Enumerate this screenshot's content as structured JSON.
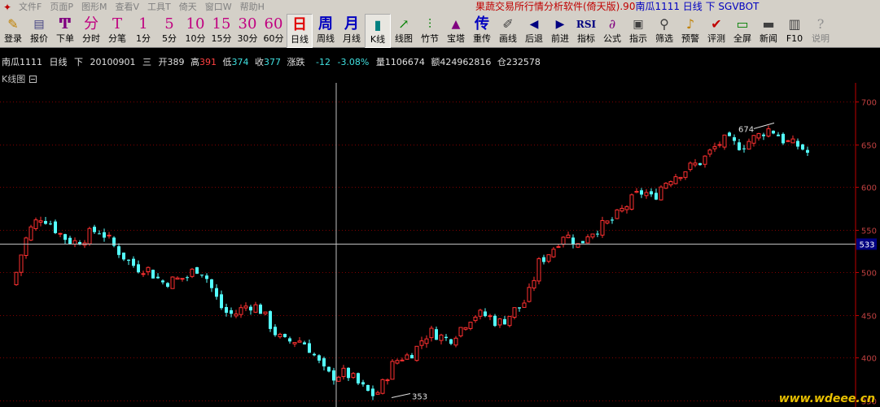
{
  "menu": {
    "items": [
      "文件F",
      "页面P",
      "图形M",
      "查看V",
      "工具T",
      "倚天",
      "窗口W",
      "帮助H"
    ],
    "title": "果蔬交易所行情分析软件(倚天版).90",
    "title_tail": "南瓜1111 日线 下 SGVBOT"
  },
  "toolbar": {
    "buttons": [
      {
        "id": "login",
        "glyph": "✎",
        "label": "登录"
      },
      {
        "id": "quote",
        "glyph": "▤",
        "label": "报价"
      },
      {
        "id": "order",
        "glyph": "Ͳ",
        "label": "下单"
      },
      {
        "id": "timeshare",
        "glyph": "分",
        "label": "分时"
      },
      {
        "id": "tick",
        "glyph": "T",
        "label": "分笔"
      },
      {
        "id": "m1",
        "glyph": "1",
        "label": "1分"
      },
      {
        "id": "m5",
        "glyph": "5",
        "label": "5分"
      },
      {
        "id": "m10",
        "glyph": "10",
        "label": "10分"
      },
      {
        "id": "m15",
        "glyph": "15",
        "label": "15分"
      },
      {
        "id": "m30",
        "glyph": "30",
        "label": "30分"
      },
      {
        "id": "m60",
        "glyph": "60",
        "label": "60分"
      },
      {
        "id": "day",
        "glyph": "日",
        "label": "日线"
      },
      {
        "id": "week",
        "glyph": "周",
        "label": "周线"
      },
      {
        "id": "month",
        "glyph": "月",
        "label": "月线"
      },
      {
        "id": "kline",
        "glyph": "▮",
        "label": "K线"
      },
      {
        "id": "linechart",
        "glyph": "↗",
        "label": "线图"
      },
      {
        "id": "bamboo",
        "glyph": "⫶",
        "label": "竹节"
      },
      {
        "id": "tower",
        "glyph": "▲",
        "label": "宝塔"
      },
      {
        "id": "overlay",
        "glyph": "传",
        "label": "重传"
      },
      {
        "id": "draw",
        "glyph": "✐",
        "label": "画线"
      },
      {
        "id": "back",
        "glyph": "◀",
        "label": "后退"
      },
      {
        "id": "forward",
        "glyph": "▶",
        "label": "前进"
      },
      {
        "id": "indicator",
        "glyph": "RSI",
        "label": "指标"
      },
      {
        "id": "formula",
        "glyph": "∂",
        "label": "公式"
      },
      {
        "id": "hint",
        "glyph": "▣",
        "label": "指示"
      },
      {
        "id": "screen",
        "glyph": "⚲",
        "label": "筛选"
      },
      {
        "id": "alert",
        "glyph": "♪",
        "label": "预警"
      },
      {
        "id": "review",
        "glyph": "✔",
        "label": "评测"
      },
      {
        "id": "fullscreen",
        "glyph": "▭",
        "label": "全屏"
      },
      {
        "id": "news",
        "glyph": "▬",
        "label": "新闻"
      },
      {
        "id": "f10",
        "glyph": "▥",
        "label": "F10"
      },
      {
        "id": "help",
        "glyph": "?",
        "label": "说明"
      }
    ]
  },
  "info": {
    "symbol": "南瓜1111",
    "period": "日线",
    "contract": "下",
    "date": "20100901",
    "weekday": "三",
    "open_label": "开",
    "open": "389",
    "high_label": "高",
    "high": "391",
    "low_label": "低",
    "low": "374",
    "close_label": "收",
    "close": "377",
    "change_label": "涨跌",
    "change": "-12",
    "change_pct": "-3.08%",
    "volume_label": "量",
    "volume": "1106674",
    "amount_label": "额",
    "amount": "424962816",
    "oi_label": "仓",
    "oi": "232578"
  },
  "panel": {
    "label": "K线图"
  },
  "chart_data": {
    "type": "candlestick",
    "y_ticks": [
      350,
      400,
      450,
      500,
      550,
      600,
      650,
      700
    ],
    "ylim": [
      342,
      722
    ],
    "crosshair_price": "533",
    "annotations": [
      {
        "label": "674",
        "type": "high",
        "value": 674
      },
      {
        "label": "353",
        "type": "low",
        "value": 353
      }
    ],
    "colors": {
      "up": "#ff3030",
      "down": "#54ffff",
      "grid": "#800000",
      "axis": "#c00000",
      "label": "#c04040"
    },
    "close_path": [
      500,
      535,
      555,
      565,
      560,
      548,
      540,
      535,
      538,
      545,
      550,
      542,
      530,
      520,
      510,
      505,
      505,
      495,
      488,
      490,
      492,
      495,
      505,
      500,
      480,
      460,
      450,
      452,
      460,
      462,
      455,
      440,
      425,
      418,
      420,
      420,
      410,
      395,
      380,
      378,
      382,
      378,
      368,
      360,
      355,
      370,
      390,
      400,
      402,
      410,
      425,
      430,
      425,
      420,
      430,
      440,
      450,
      450,
      448,
      440,
      445,
      455,
      460,
      478,
      510,
      520,
      530,
      545,
      540,
      530,
      545,
      550,
      555,
      560,
      570,
      580,
      590,
      595,
      585,
      600,
      610,
      615,
      620,
      625,
      630,
      640,
      650,
      655,
      650,
      648,
      655,
      660,
      668,
      665,
      655,
      650,
      648,
      640
    ]
  },
  "watermark": "www.wdeee.cn"
}
